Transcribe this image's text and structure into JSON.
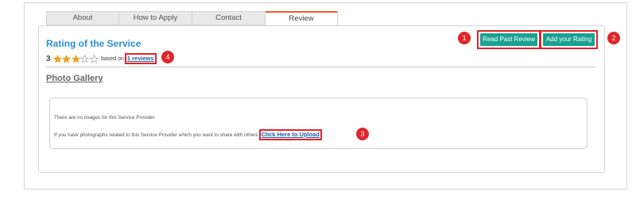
{
  "tabs": [
    {
      "label": "About",
      "active": false
    },
    {
      "label": "How to Apply",
      "active": false
    },
    {
      "label": "Contact",
      "active": false
    },
    {
      "label": "Review",
      "active": true
    }
  ],
  "rating": {
    "title": "Rating of the Service",
    "score": "3",
    "stars_filled": 3,
    "stars_total": 5,
    "based_on_text": "based on",
    "reviews_link": "1 reviews"
  },
  "buttons": {
    "read_past_review": "Read Past Review",
    "add_your_rating": "Add your Rating"
  },
  "gallery": {
    "title": "Photo Gallery",
    "no_images": "There are no images for this Service Provider",
    "share_prompt": "If you have photographs related to this Service Provider which you want to share with others",
    "upload_link": "Click Here to Upload"
  },
  "badges": {
    "b1": "1",
    "b2": "2",
    "b3": "3",
    "b4": "4"
  },
  "colors": {
    "accent_blue": "#2e8fd4",
    "button_teal": "#1aa192",
    "highlight_red": "#e0252a",
    "star_orange": "#f0a020",
    "active_tab_border": "#e8612c"
  }
}
